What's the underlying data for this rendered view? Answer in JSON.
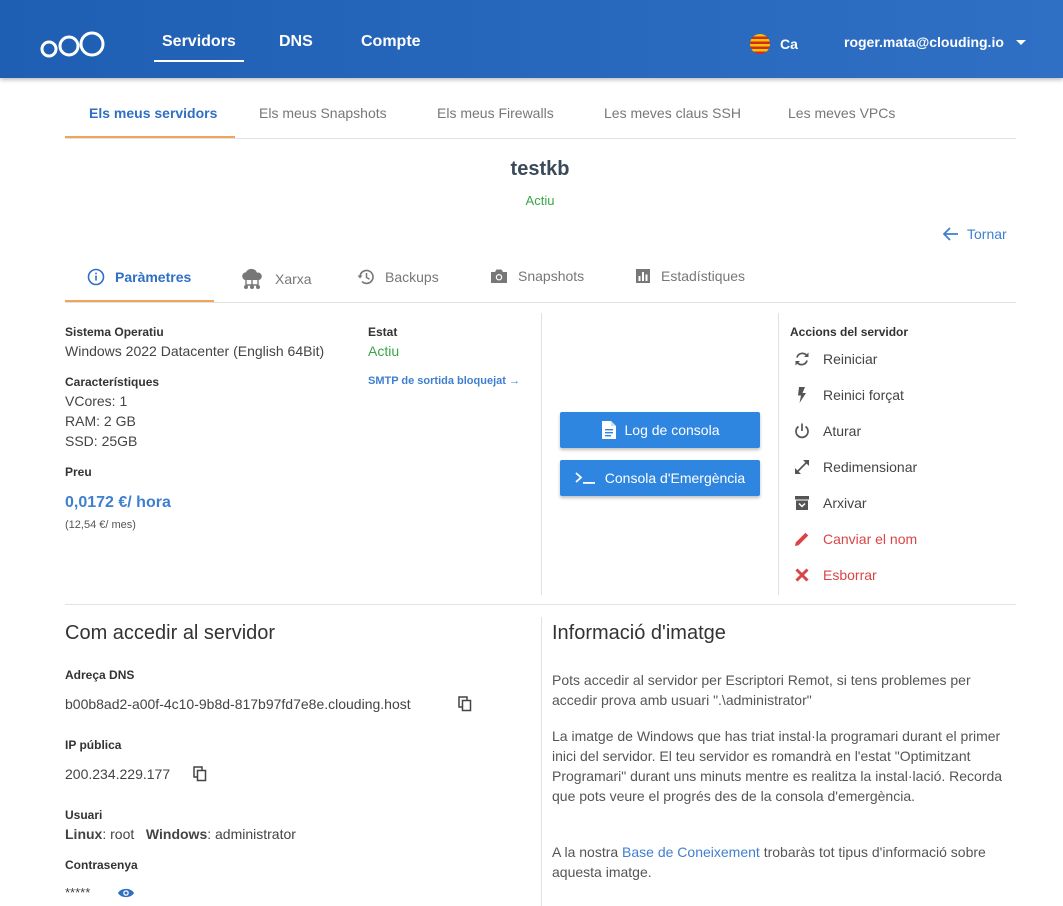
{
  "header": {
    "nav": [
      "Servidors",
      "DNS",
      "Compte"
    ],
    "language": "Ca",
    "user_email": "roger.mata@clouding.io"
  },
  "subtabs": [
    "Els meus servidors",
    "Els meus Snapshots",
    "Els meus Firewalls",
    "Les meves claus SSH",
    "Les meves VPCs"
  ],
  "server": {
    "name": "testkb",
    "status": "Actiu",
    "back_label": "Tornar"
  },
  "detail_tabs": [
    "Paràmetres",
    "Xarxa",
    "Backups",
    "Snapshots",
    "Estadístiques"
  ],
  "params": {
    "os_label": "Sistema Operatiu",
    "os_value": "Windows 2022 Datacenter (English 64Bit)",
    "state_label": "Estat",
    "state_value": "Actiu",
    "smtp_link": "SMTP de sortida bloquejat →",
    "features_label": "Característiques",
    "vcores": "VCores: 1",
    "ram": "RAM: 2 GB",
    "ssd": "SSD: 25GB",
    "price_label": "Preu",
    "price_hour": "0,0172 €/ hora",
    "price_month": "(12,54 €/ mes)"
  },
  "buttons": {
    "log": "Log de consola",
    "console": "Consola d'Emergència"
  },
  "actions": {
    "title": "Accions del servidor",
    "items": [
      "Reiniciar",
      "Reinici forçat",
      "Aturar",
      "Redimensionar",
      "Arxivar",
      "Canviar el nom",
      "Esborrar"
    ]
  },
  "access": {
    "title": "Com accedir al servidor",
    "dns_label": "Adreça DNS",
    "dns_value": "b00b8ad2-a00f-4c10-9b8d-817b97fd7e8e.clouding.host",
    "ip_label": "IP pública",
    "ip_value": "200.234.229.177",
    "user_label": "Usuari",
    "linux_label": "Linux",
    "linux_user": ": root",
    "windows_label": "Windows",
    "windows_user": ": administrator",
    "password_label": "Contrasenya",
    "password_value": "*****"
  },
  "image_info": {
    "title": "Informació d'imatge",
    "p1": "Pots accedir al servidor per Escriptori Remot, si tens problemes per accedir prova amb usuari \".\\administrator\"",
    "p2": "La imatge de Windows que has triat instal·la programari durant el primer inici del servidor. El teu servidor es romandrà en l'estat \"Optimitzant Programari\" durant uns minuts mentre es realitza la instal·lació. Recorda que pots veure el progrés des de la consola d'emergència.",
    "p3_before": "A la nostra ",
    "p3_link": "Base de Coneixement",
    "p3_after": " trobaràs tot tipus d'informació sobre aquesta imatge."
  },
  "colors": {
    "header": "#2f6fc4",
    "accent": "#3f7fd0",
    "button": "#2f86e0",
    "active_green": "#3aa64a",
    "tab_underline": "#f0a35a",
    "danger": "#d94545"
  }
}
